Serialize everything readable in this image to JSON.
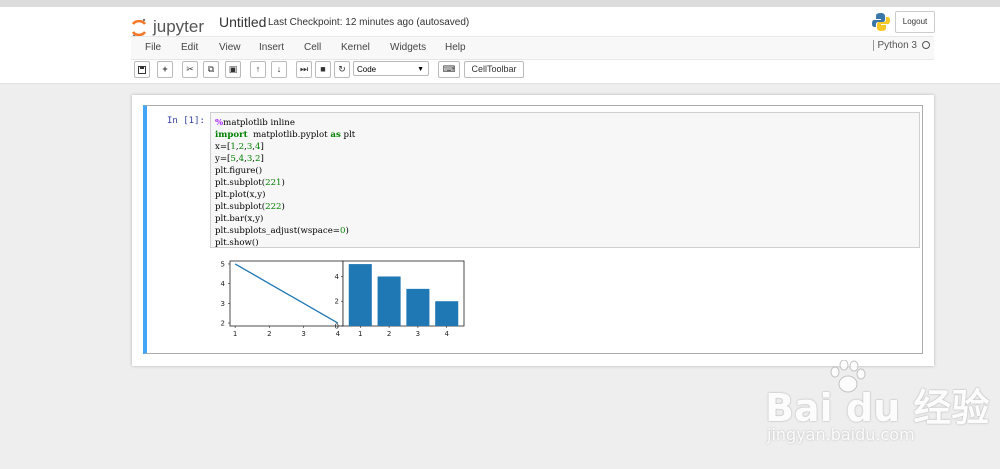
{
  "app": {
    "logo_text": "jupyter",
    "notebook_name": "Untitled",
    "checkpoint": "Last Checkpoint: 12 minutes ago (autosaved)",
    "logout_label": "Logout",
    "kernel_name": "Python 3"
  },
  "menu": [
    "File",
    "Edit",
    "View",
    "Insert",
    "Cell",
    "Kernel",
    "Widgets",
    "Help"
  ],
  "toolbar": {
    "cell_type": "Code",
    "celltoolbar_label": "CellToolbar"
  },
  "cell": {
    "prompt": "In  [1]:",
    "code_lines": [
      "%matplotlib inline",
      "import  matplotlib.pyplot as plt",
      "x=[1,2,3,4]",
      "y=[5,4,3,2]",
      "plt.figure()",
      "plt.subplot(221)",
      "plt.plot(x,y)",
      "plt.subplot(222)",
      "plt.bar(x,y)",
      "plt.subplots_adjust(wspace=0)",
      "plt.show()"
    ]
  },
  "chart_data": [
    {
      "type": "line",
      "x": [
        1,
        2,
        3,
        4
      ],
      "y": [
        5,
        4,
        3,
        2
      ],
      "xticks": [
        "1",
        "2",
        "3",
        "4"
      ],
      "yticks": [
        "2",
        "3",
        "4",
        "5"
      ],
      "color": "#1f77b4"
    },
    {
      "type": "bar",
      "categories": [
        "1",
        "2",
        "3",
        "4"
      ],
      "values": [
        5,
        4,
        3,
        2
      ],
      "yticks": [
        "0",
        "2",
        "4"
      ],
      "color": "#1f77b4"
    }
  ],
  "watermark": {
    "brand": "Bai du 经验",
    "url": "jingyan.baidu.com"
  }
}
